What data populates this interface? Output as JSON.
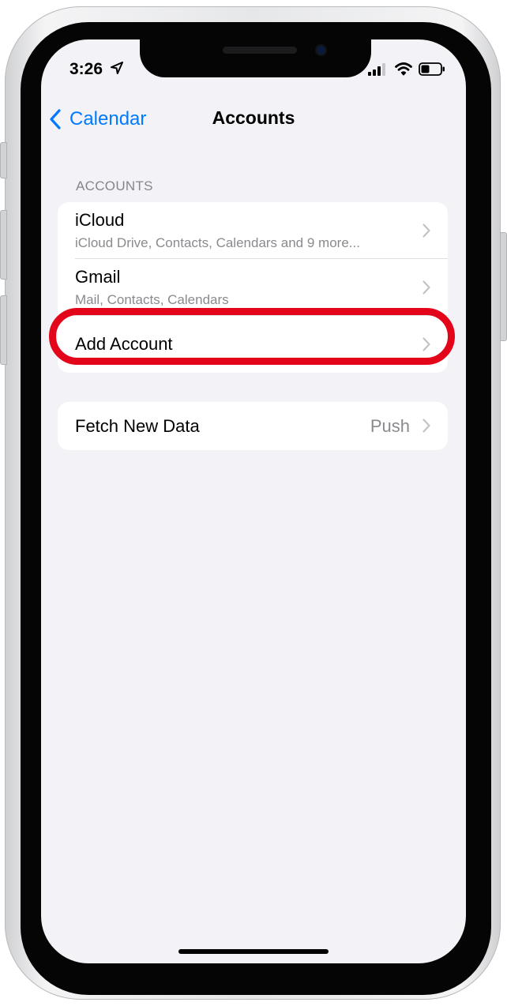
{
  "status_bar": {
    "time": "3:26"
  },
  "nav": {
    "back_label": "Calendar",
    "title": "Accounts"
  },
  "accounts_section": {
    "header": "ACCOUNTS",
    "items": [
      {
        "title": "iCloud",
        "subtitle": "iCloud Drive, Contacts, Calendars and 9 more..."
      },
      {
        "title": "Gmail",
        "subtitle": "Mail, Contacts, Calendars"
      },
      {
        "title": "Add Account"
      }
    ]
  },
  "fetch_section": {
    "title": "Fetch New Data",
    "value": "Push"
  },
  "colors": {
    "accent": "#007aff",
    "background": "#f2f2f7",
    "highlight": "#e3061a",
    "secondary_text": "#8a8a8e"
  },
  "icons": [
    "location-icon",
    "signal-icon",
    "wifi-icon",
    "battery-icon",
    "chevron-left-icon",
    "chevron-right-icon"
  ]
}
